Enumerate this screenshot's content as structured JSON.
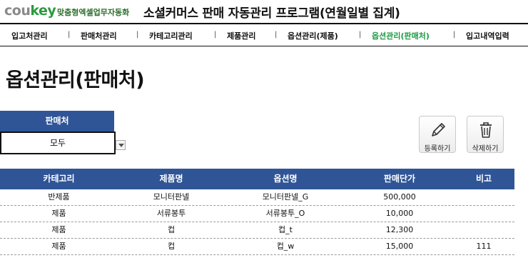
{
  "header": {
    "logo_part1": "cou",
    "logo_part2": "key",
    "logo_subtitle": "맞춤형엑셀업무자동화",
    "app_title": "소셜커머스 판매 자동관리 프로그램(연월일별 집계)"
  },
  "nav": {
    "items": [
      {
        "label": "입고처관리"
      },
      {
        "label": "판매처관리"
      },
      {
        "label": "카테고리관리"
      },
      {
        "label": "제품관리"
      },
      {
        "label": "옵션관리(제품)"
      },
      {
        "label": "옵션관리(판매처)"
      },
      {
        "label": "입고내역입력"
      }
    ],
    "separator": "|",
    "active_color": "#1f9b45"
  },
  "page": {
    "title": "옵션관리(판매처)"
  },
  "filter": {
    "label": "판매처",
    "value": "모두"
  },
  "actions": {
    "register_label": "등록하기",
    "delete_label": "삭제하기"
  },
  "table": {
    "headers": [
      "카테고리",
      "제품명",
      "옵션명",
      "판매단가",
      "비고"
    ],
    "rows": [
      [
        "반제품",
        "모니터판넬",
        "모니터판넬_G",
        "500,000",
        ""
      ],
      [
        "제품",
        "서류봉투",
        "서류봉투_O",
        "10,000",
        ""
      ],
      [
        "제품",
        "컵",
        "컵_t",
        "12,300",
        ""
      ],
      [
        "제품",
        "컵",
        "컵_w",
        "15,000",
        "111"
      ]
    ],
    "header_bg": "#2f5597"
  },
  "colors": {
    "brand_green": "#2b9a3e",
    "accent_blue": "#2f5597"
  }
}
